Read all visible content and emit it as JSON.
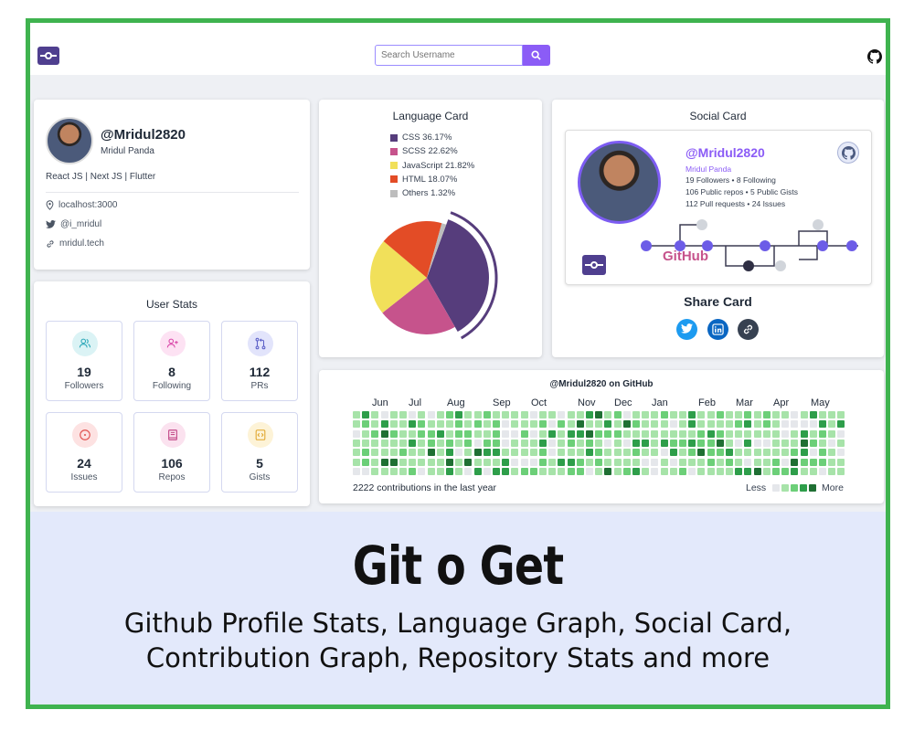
{
  "search": {
    "placeholder": "Search Username"
  },
  "profile": {
    "handle": "@Mridul2820",
    "name": "Mridul Panda",
    "bio": "React JS | Next JS | Flutter",
    "location": "localhost:3000",
    "twitter": "@i_mridul",
    "website": "mridul.tech"
  },
  "user_stats": {
    "title": "User Stats",
    "items": [
      {
        "value": "19",
        "label": "Followers",
        "icon": "users-icon",
        "bg": "#dbf3f5",
        "color": "#2aa7b8"
      },
      {
        "value": "8",
        "label": "Following",
        "icon": "user-plus-icon",
        "bg": "#fde2f3",
        "color": "#d946a8"
      },
      {
        "value": "112",
        "label": "PRs",
        "icon": "pull-request-icon",
        "bg": "#e2e4fb",
        "color": "#5b5fc7"
      },
      {
        "value": "24",
        "label": "Issues",
        "icon": "issue-icon",
        "bg": "#fde2e2",
        "color": "#e0524f"
      },
      {
        "value": "106",
        "label": "Repos",
        "icon": "book-icon",
        "bg": "#fbe2ef",
        "color": "#c44c8a"
      },
      {
        "value": "5",
        "label": "Gists",
        "icon": "code-icon",
        "bg": "#fdf3d7",
        "color": "#e0a52a"
      }
    ]
  },
  "language_card": {
    "title": "Language Card"
  },
  "chart_data": {
    "type": "pie",
    "title": "Language Card",
    "series": [
      {
        "name": "CSS",
        "value": 36.17,
        "label": "CSS  36.17%",
        "color": "#563d7c"
      },
      {
        "name": "SCSS",
        "value": 22.62,
        "label": "SCSS  22.62%",
        "color": "#c6538c"
      },
      {
        "name": "JavaScript",
        "value": 21.82,
        "label": "JavaScript  21.82%",
        "color": "#f1e05a"
      },
      {
        "name": "HTML",
        "value": 18.07,
        "label": "HTML  18.07%",
        "color": "#e34c26"
      },
      {
        "name": "Others",
        "value": 1.32,
        "label": "Others  1.32%",
        "color": "#bdbdbd"
      }
    ]
  },
  "social_card": {
    "title": "Social Card",
    "handle": "@Mridul2820",
    "name": "Mridul Panda",
    "line1": "19 Followers  •  8 Following",
    "line2": "106 Public repos  •  5 Public Gists",
    "line3": "112 Pull requests  •  24 Issues",
    "brand": "GitHub",
    "share_title": "Share Card"
  },
  "contributions": {
    "title": "@Mridul2820 on GitHub",
    "months": [
      "Jun",
      "Jul",
      "Aug",
      "Sep",
      "Oct",
      "Nov",
      "Dec",
      "Jan",
      "Feb",
      "Mar",
      "Apr",
      "May"
    ],
    "total_text": "2222 contributions in the last year",
    "less": "Less",
    "more": "More",
    "levels": [
      "#e5e7eb",
      "#a7e3a9",
      "#6ccf78",
      "#2e9e4a",
      "#1f6f33"
    ]
  },
  "banner": {
    "title": "Git o Get",
    "line1": "Github Profile Stats, Language Graph, Social Card,",
    "line2": "Contribution Graph, Repository Stats and more"
  }
}
